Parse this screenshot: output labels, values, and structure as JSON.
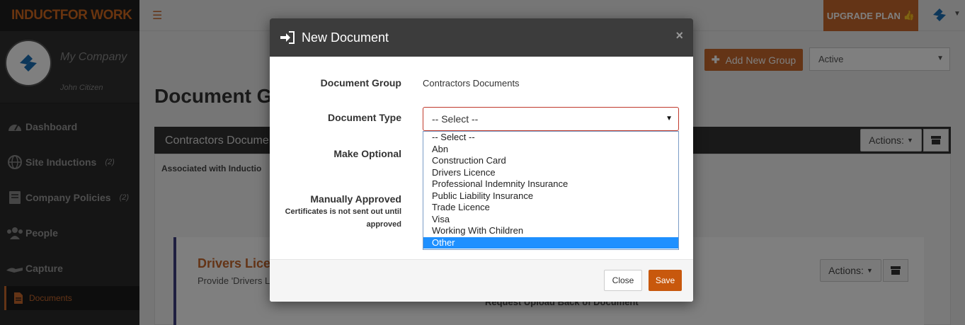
{
  "app": {
    "logo": "INDUCTFOR WORK",
    "upgrade_label": "UPGRADE PLAN"
  },
  "sidebar": {
    "company": "My Company",
    "user": "John Citizen",
    "items": [
      {
        "label": "Dashboard",
        "count": ""
      },
      {
        "label": "Site Inductions",
        "count": "(2)"
      },
      {
        "label": "Company Policies",
        "count": "(2)"
      },
      {
        "label": "People",
        "count": ""
      },
      {
        "label": "Capture",
        "count": ""
      }
    ],
    "sub_item": "Documents"
  },
  "main": {
    "add_group_label": "Add New Group",
    "status_filter": "Active",
    "page_title": "Document G",
    "panel_title": "Contractors Docume",
    "associated_label": "Associated with Inductio",
    "actions_label": "Actions:",
    "card_title": "Drivers Lice",
    "card_desc": "Provide 'Drivers L",
    "card_footer": "Request Upload     Back of Document"
  },
  "modal": {
    "title": "New Document",
    "close_glyph": "×",
    "fields": {
      "group_label": "Document Group",
      "group_value": "Contractors Documents",
      "type_label": "Document Type",
      "type_value": "-- Select --",
      "optional_label": "Make Optional",
      "approved_label": "Manually Approved",
      "approved_hint": "Certificates is not sent out until approved"
    },
    "options": [
      "-- Select --",
      "Abn",
      "Construction Card",
      "Drivers Licence",
      "Professional Indemnity Insurance",
      "Public Liability Insurance",
      "Trade Licence",
      "Visa",
      "Working With Children",
      "Other"
    ],
    "highlighted_option": "Other",
    "close_button": "Close",
    "save_button": "Save"
  },
  "colors": {
    "accent": "#c8682d",
    "highlight": "#1e90ff",
    "error_border": "#c0392b"
  }
}
